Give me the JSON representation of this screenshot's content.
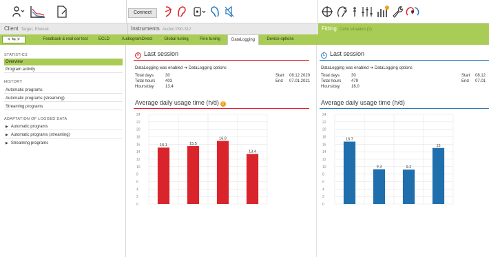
{
  "toolbar": {
    "connect_label": "Connect",
    "icons": [
      "client-icon",
      "audiogram-icon",
      "document-icon",
      "hearing-aid-red-icon",
      "ear-red-icon",
      "program-icon",
      "ear-blue-icon",
      "no-sound-icon",
      "target-icon",
      "profile-icon",
      "tuning-icon",
      "sliders-icon",
      "equalizer-icon",
      "wrench-icon",
      "datalog-icon"
    ]
  },
  "info": {
    "client_label": "Client",
    "client_name": "Target, Phonak",
    "instruments_label": "Instruments",
    "instruments_name": "Audéo P90-312",
    "fitting_label": "Fitting",
    "fitting_sub": "Calm situation (2)"
  },
  "tabs": {
    "nav_label": "< ⇆ >",
    "items": [
      "Feedback & real ear test",
      "ECLD",
      "AudiogramDirect",
      "Global tuning",
      "Fine tuning",
      "DataLogging",
      "Device options"
    ],
    "active": "DataLogging"
  },
  "sidebar": {
    "statistics_head": "STATISTICS",
    "overview": "Overview",
    "program_activity": "Program activity",
    "history_head": "HISTORY",
    "auto_programs": "Automatic programs",
    "auto_programs_streaming": "Automatic programs (streaming)",
    "streaming_programs": "Streaming programs",
    "adaptation_head": "ADAPTATION OF LOGGED DATA",
    "adapt_auto": "Automatic programs",
    "adapt_auto_streaming": "Automatic programs (streaming)",
    "adapt_streaming": "Streaming programs"
  },
  "left": {
    "side_letter": "R",
    "title": "Last session",
    "dl_enabled": "DataLogging was enabled",
    "dl_options": "DataLogging options",
    "total_days_label": "Total days",
    "total_days": "30",
    "total_hours_label": "Total hours",
    "total_hours": "403",
    "hours_day_label": "Hours/day",
    "hours_day": "13.4",
    "start_label": "Start",
    "start_value": "08.12.2020",
    "end_label": "End",
    "end_value": "07.01.2021",
    "chart_title": "Average daily usage time (h/d)",
    "warn_icon": "!",
    "color": "#d9242b"
  },
  "right": {
    "side_letter": "L",
    "title": "Last session",
    "dl_enabled": "DataLogging was enabled",
    "dl_options": "DataLogging options",
    "total_days_label": "Total days",
    "total_days": "30",
    "total_hours_label": "Total hours",
    "total_hours": "479",
    "hours_day_label": "Hours/day",
    "hours_day": "16.0",
    "start_label": "Start",
    "start_value": "08.12",
    "end_label": "End",
    "end_value": "07.01",
    "chart_title": "Average daily usage time (h/d)",
    "color": "#1f6fad"
  },
  "chart_data": [
    {
      "type": "bar",
      "categories": [
        "09.09.20",
        "08.10.20",
        "08.11.20",
        "08.12.20",
        "07.01.21"
      ],
      "values": [
        15.1,
        15.5,
        16.9,
        13.4
      ],
      "bar_labels": [
        "15.1",
        "15.5",
        "16.9",
        "13.4"
      ],
      "title": "Average daily usage time (h/d)",
      "ylim": [
        0,
        24
      ],
      "yticks": [
        "24",
        "22",
        "20",
        "18",
        "16",
        "14",
        "12",
        "10",
        "8",
        "6",
        "4",
        "2",
        "0"
      ],
      "grid": true,
      "color": "#d9242b"
    },
    {
      "type": "bar",
      "categories": [
        "09.09.20",
        "08.10.20",
        "08.11.20",
        "08.12.20",
        "07.01.21"
      ],
      "values": [
        16.7,
        9.3,
        9.2,
        15
      ],
      "bar_labels": [
        "16.7",
        "9.3",
        "9.2",
        "15"
      ],
      "title": "Average daily usage time (h/d)",
      "ylim": [
        0,
        24
      ],
      "yticks": [
        "24",
        "22",
        "20",
        "18",
        "16",
        "14",
        "12",
        "10",
        "8",
        "6",
        "4",
        "2",
        "0"
      ],
      "grid": true,
      "color": "#1f6fad"
    }
  ]
}
